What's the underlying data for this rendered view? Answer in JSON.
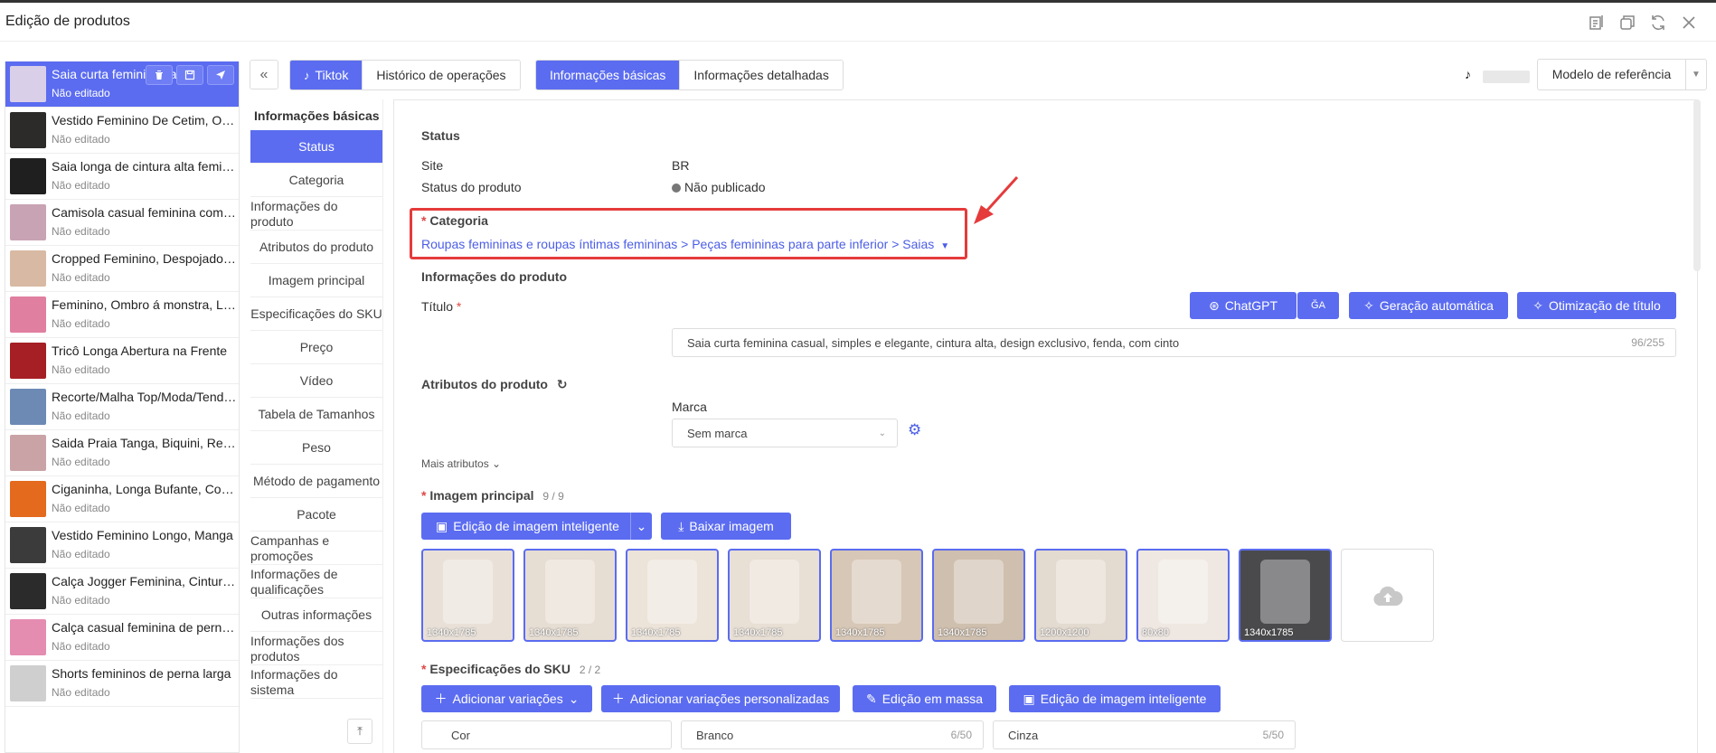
{
  "window": {
    "title": "Edição de produtos"
  },
  "products": [
    {
      "name": "Saia curta feminina casual, simples e elegante",
      "status": "Não editado",
      "active": true,
      "thumb": "#d9cfe9"
    },
    {
      "name": "Vestido Feminino De Cetim, Ombro a Ombro",
      "status": "Não editado",
      "thumb": "#2d2a2a"
    },
    {
      "name": "Saia longa de cintura alta feminina",
      "status": "Não editado",
      "thumb": "#1f1f1f"
    },
    {
      "name": "Camisola casual feminina com decote",
      "status": "Não editado",
      "thumb": "#c8a3b4"
    },
    {
      "name": "Cropped Feminino, Despojado e Moderno",
      "status": "Não editado",
      "thumb": "#d8b9a4"
    },
    {
      "name": "Feminino, Ombro á monstra, Longo",
      "status": "Não editado",
      "thumb": "#e07fa0"
    },
    {
      "name": "Tricô Longa Abertura na Frente",
      "status": "Não editado",
      "thumb": "#a51f25"
    },
    {
      "name": "Recorte/Malha Top/Moda/Tendência",
      "status": "Não editado",
      "thumb": "#6d8ab5"
    },
    {
      "name": "Saida Praia Tanga, Biquini, Renda",
      "status": "Não editado",
      "thumb": "#caa3a6"
    },
    {
      "name": "Ciganinha, Longa Bufante, Comprida",
      "status": "Não editado",
      "thumb": "#e46a1e"
    },
    {
      "name": "Vestido Feminino Longo, Manga",
      "status": "Não editado",
      "thumb": "#3b3b3b"
    },
    {
      "name": "Calça Jogger Feminina, Cintura Alta",
      "status": "Não editado",
      "thumb": "#2b2b2b"
    },
    {
      "name": "Calça casual feminina de perna larga",
      "status": "Não editado",
      "thumb": "#e58cb1"
    },
    {
      "name": "Shorts femininos de perna larga",
      "status": "Não editado",
      "thumb": "#cfcfcf"
    }
  ],
  "tabs": {
    "platform": [
      {
        "label": "Tiktok",
        "active": true
      },
      {
        "label": "Histórico de operações"
      }
    ],
    "info": [
      {
        "label": "Informações básicas",
        "active": true
      },
      {
        "label": "Informações detalhadas"
      }
    ]
  },
  "reference_model": "Modelo de referência",
  "secnav": {
    "header": "Informações básicas",
    "items": [
      {
        "label": "Status",
        "active": true
      },
      {
        "label": "Categoria"
      },
      {
        "label": "Informações do produto",
        "two": true
      },
      {
        "label": "Atributos do produto"
      },
      {
        "label": "Imagem principal"
      },
      {
        "label": "Especificações do SKU"
      },
      {
        "label": "Preço"
      },
      {
        "label": "Vídeo"
      },
      {
        "label": "Tabela de Tamanhos"
      },
      {
        "label": "Peso"
      },
      {
        "label": "Método de pagamento"
      },
      {
        "label": "Pacote"
      },
      {
        "label": "Campanhas e promoções",
        "two": true
      },
      {
        "label": "Informações de qualificações",
        "two": true
      },
      {
        "label": "Outras informações"
      },
      {
        "label": "Informações dos produtos",
        "two": true
      },
      {
        "label": "Informações do sistema",
        "two": true
      }
    ]
  },
  "status": {
    "heading": "Status",
    "site_label": "Site",
    "site_value": "BR",
    "product_status_label": "Status do produto",
    "product_status_value": "Não publicado"
  },
  "category": {
    "required_mark": "*",
    "label": "Categoria",
    "path": "Roupas femininas e roupas íntimas femininas > Peças femininas para parte inferior > Saias"
  },
  "product_info": {
    "heading": "Informações do produto",
    "title_label": "Título",
    "title_value": "Saia curta feminina casual, simples e elegante, cintura alta, design exclusivo, fenda, com cinto",
    "title_count": "96/255",
    "buttons": {
      "chatgpt": "ChatGPT",
      "translate": "ĞA",
      "auto_gen": "Geração automática",
      "title_opt": "Otimização de título"
    }
  },
  "attributes": {
    "heading": "Atributos do produto",
    "brand_label": "Marca",
    "brand_value": "Sem marca",
    "more": "Mais atributos"
  },
  "main_image": {
    "heading": "Imagem principal",
    "count": "9 / 9",
    "smart_edit": "Edição de imagem inteligente",
    "download": "Baixar imagem",
    "images": [
      {
        "dim": "1340x1785",
        "color": "#e9e1d8"
      },
      {
        "dim": "1340x1785",
        "color": "#e6ddd3"
      },
      {
        "dim": "1340x1785",
        "color": "#ece3d9"
      },
      {
        "dim": "1340x1785",
        "color": "#e8dfd5"
      },
      {
        "dim": "1340x1785",
        "color": "#d7c7b6"
      },
      {
        "dim": "1340x1785",
        "color": "#cfbfae"
      },
      {
        "dim": "1200x1200",
        "color": "#e3dad0"
      },
      {
        "dim": "80x80",
        "color": "#efe8e2"
      },
      {
        "dim": "1340x1785",
        "color": "#4a4a4d"
      }
    ]
  },
  "sku": {
    "heading": "Especificações do SKU",
    "count": "2 / 2",
    "buttons": {
      "add_var": "Adicionar variações",
      "add_custom": "Adicionar variações personalizadas",
      "mass_edit": "Edição em massa",
      "smart_img": "Edição de imagem inteligente"
    },
    "color_label": "Cor",
    "values": [
      {
        "value": "Branco",
        "count": "6/50"
      },
      {
        "value": "Cinza",
        "count": "5/50"
      }
    ]
  },
  "colors": {
    "accent": "#5b6cf0",
    "highlight": "#e53b3b"
  }
}
